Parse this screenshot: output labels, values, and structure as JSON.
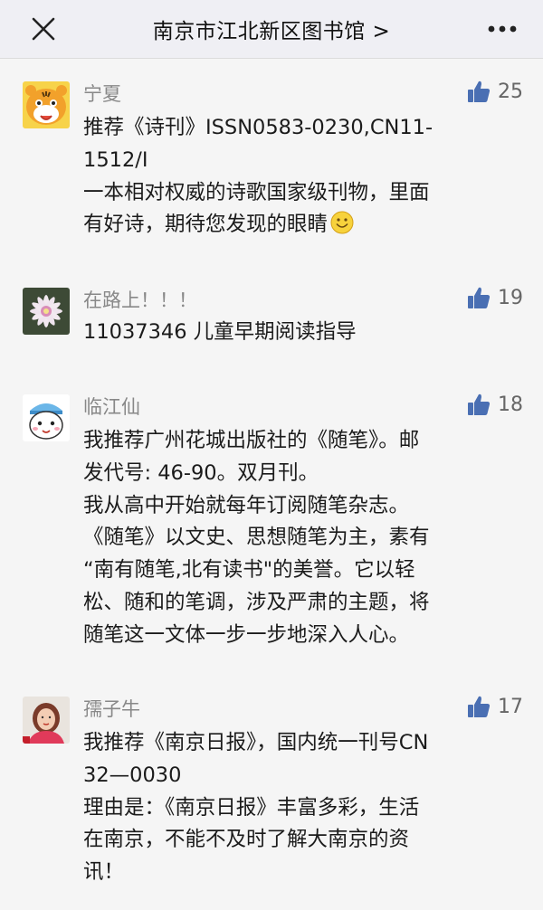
{
  "header": {
    "title": "南京市江北新区图书馆 >"
  },
  "comments": [
    {
      "name": "宁夏",
      "likes": "25",
      "avatar_icon": "tiger-avatar",
      "lines": [
        "推荐《诗刊》ISSN0583-0230,CN11-",
        "1512/I",
        "一本相对权威的诗歌国家级刊物，里面",
        "有好诗，期待您发现的眼睛"
      ],
      "emoji": "smile-emoji"
    },
    {
      "name": "在路上！！！",
      "likes": "19",
      "avatar_icon": "flower-avatar",
      "lines": [
        "11037346 儿童早期阅读指导"
      ]
    },
    {
      "name": "临江仙",
      "likes": "18",
      "avatar_icon": "cartoon-avatar",
      "lines": [
        "我推荐广州花城出版社的《随笔》。邮",
        "发代号: 46-90。双月刊。",
        "我从高中开始就每年订阅随笔杂志。",
        "《随笔》以文史、思想随笔为主，素有",
        "“南有随笔,北有读书\"的美誉。它以轻",
        "松、随和的笔调，涉及严肃的主题，将",
        "随笔这一文体一步一步地深入人心。"
      ]
    },
    {
      "name": "孺子牛",
      "likes": "17",
      "avatar_icon": "woman-photo-avatar",
      "lines": [
        "我推荐《南京日报》，国内统一刊号CN",
        "32—0030",
        "理由是：《南京日报》丰富多彩，生活",
        "在南京，不能不及时了解大南京的资",
        "讯！"
      ]
    }
  ],
  "colors": {
    "thumb": "#4a6fb3",
    "header_bg": "#efeff4",
    "page_bg": "#f5f5f5"
  }
}
